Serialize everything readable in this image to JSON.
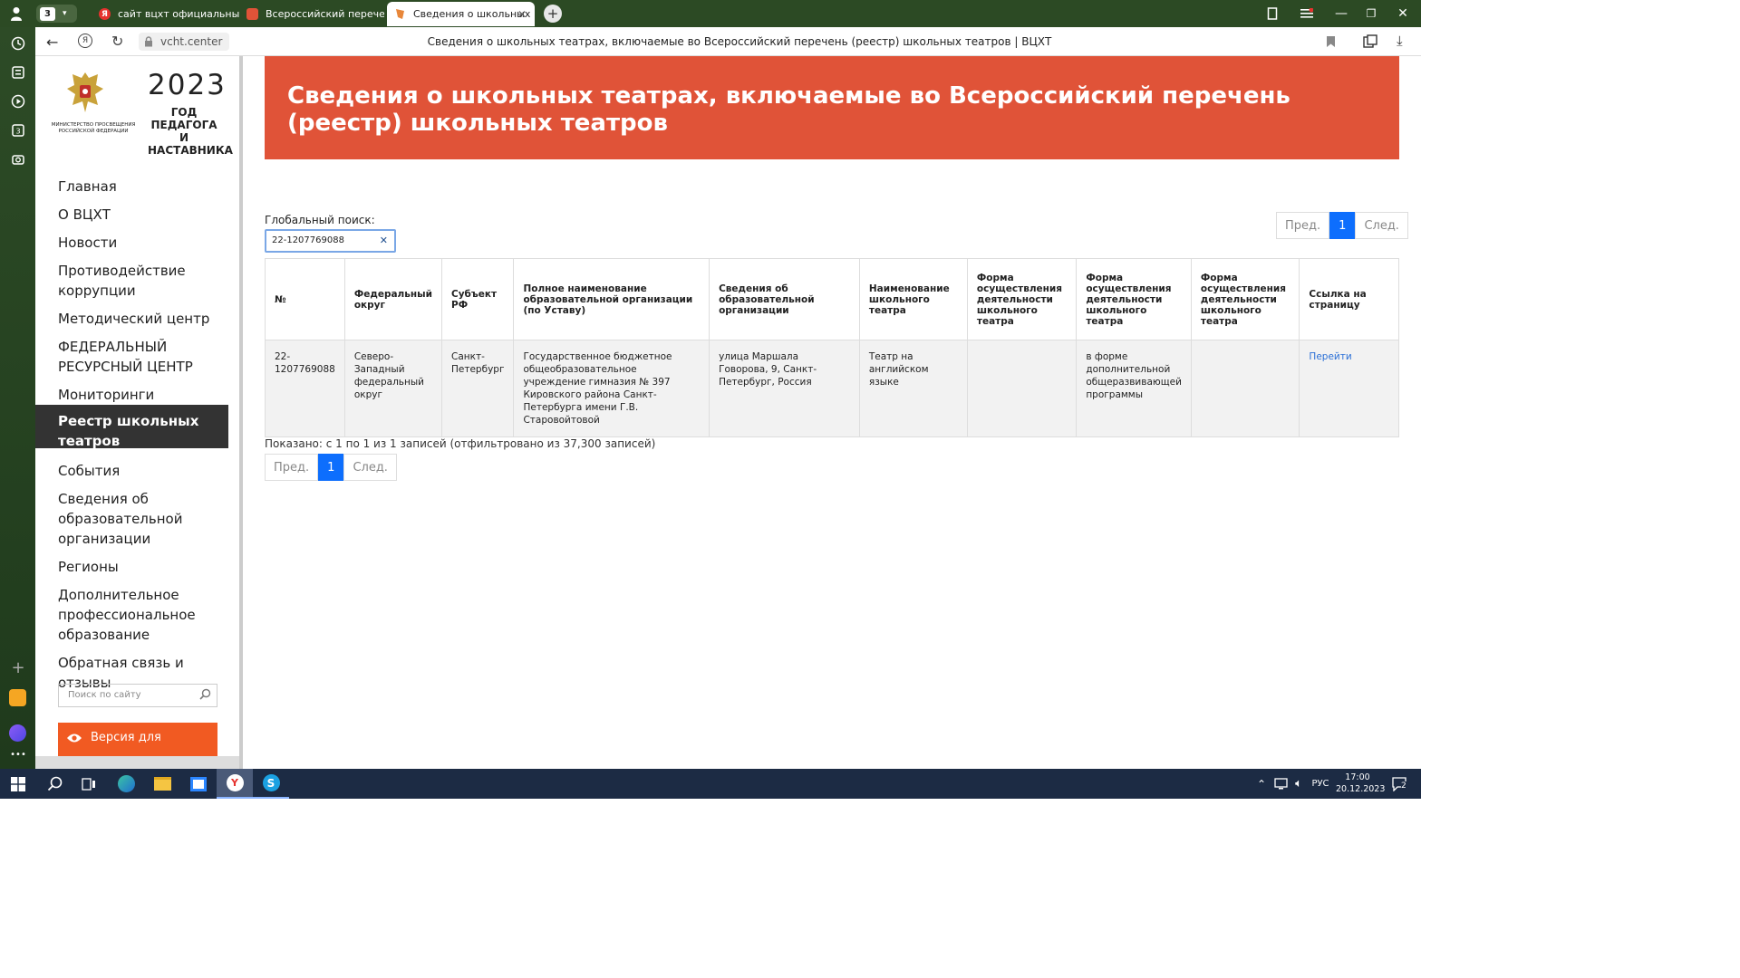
{
  "browser": {
    "tab_counter": "3",
    "tabs": [
      {
        "label": "сайт вцхт официальный с",
        "favicon": "Я",
        "color": "#e6322e"
      },
      {
        "label": "Всероссийский перечень",
        "favicon": "",
        "color": "#e05338"
      },
      {
        "label": "Сведения о школьных",
        "favicon": "",
        "color": "#e05338"
      }
    ],
    "url": "vcht.center",
    "page_title": "Сведения о школьных театрах, включаемые во Всероссийский перечень (реестр) школьных театров | ВЦХТ"
  },
  "sidebar": {
    "logo_ministry": "МИНИСТЕРСТВО ПРОСВЕЩЕНИЯ РОССИЙСКОЙ ФЕДЕРАЦИИ",
    "logo_year": "2023",
    "logo_year_text_1": "ГОД ПЕДАГОГА",
    "logo_year_text_2": "И НАСТАВНИКА",
    "items": [
      {
        "label": "Главная"
      },
      {
        "label": "О ВЦХТ"
      },
      {
        "label": "Новости"
      },
      {
        "label": "Противодействие коррупции"
      },
      {
        "label": "Методический центр"
      },
      {
        "label": "ФЕДЕРАЛЬНЫЙ РЕСУРСНЫЙ ЦЕНТР"
      },
      {
        "label": "Мониторинги"
      },
      {
        "label": "Реестр школьных театров"
      },
      {
        "label": "События"
      },
      {
        "label": "Сведения об образовательной организации"
      },
      {
        "label": "Регионы"
      },
      {
        "label": "Дополнительное профессиональное образование"
      },
      {
        "label": "Обратная связь и отзывы"
      }
    ],
    "active_item": "Реестр школьных театров",
    "search_placeholder": "Поиск по сайту",
    "vision_button": "Версия для"
  },
  "main": {
    "title": "Сведения о школьных театрах, включаемые во Всероссийский перечень (реестр) школьных театров",
    "search_label": "Глобальный поиск:",
    "search_value": "22-1207769088",
    "pager": {
      "prev": "Пред.",
      "current": "1",
      "next": "След."
    },
    "columns": [
      "№",
      "Федеральный округ",
      "Субъект РФ",
      "Полное наименование образовательной организации (по Уставу)",
      "Сведения об образовательной организации",
      "Наименование школьного театра",
      "Форма осуществления деятельности школьного театра",
      "Форма осуществления деятельности школьного театра",
      "Форма осуществления деятельности школьного театра",
      "Ссылка на страницу"
    ],
    "rows": [
      [
        "22-1207769088",
        "Северо-Западный федеральный округ",
        "Санкт-Петербург",
        "Государственное бюджетное общеобразовательное учреждение гимназия № 397 Кировского района Санкт- Петербурга имени Г.В. Старовойтовой",
        "улица Маршала Говорова, 9, Санкт-Петербург, Россия",
        "Театр на английском языке",
        "",
        "в форме дополнительной общеразвивающей программы",
        "",
        "Перейти"
      ]
    ],
    "info": "Показано: с 1 по 1 из 1 записей (отфильтровано из 37,300 записей)"
  },
  "taskbar": {
    "lang": "РУС",
    "time": "17:00",
    "date": "20.12.2023",
    "notifications": "2"
  },
  "colors": {
    "banner": "#e05338",
    "accent_blue": "#0d6efd",
    "vision_button": "#f15a22"
  }
}
